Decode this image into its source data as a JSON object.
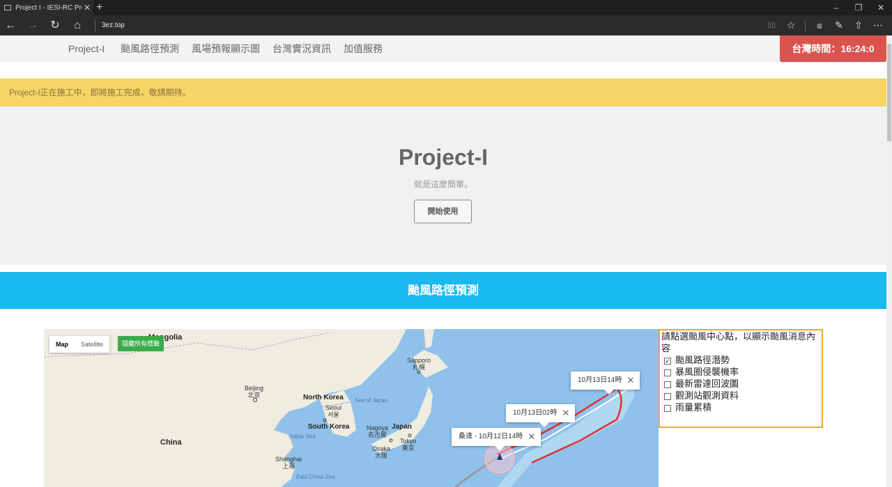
{
  "browser": {
    "tab_title": "Project I - IESI-RC Produ",
    "url": "3ez.top",
    "new_tab_symbol": "+",
    "close_symbol": "✕",
    "win_min": "–",
    "win_max": "❐",
    "win_close": "✕",
    "back": "←",
    "forward": "→",
    "refresh": "↻",
    "home": "⌂",
    "tool_reading": "▯▯",
    "tool_favorite": "☆",
    "tool_hub": "≡",
    "tool_note": "✎",
    "tool_share": "⇧",
    "tool_more": "⋯"
  },
  "navbar": {
    "brand": "Project-I",
    "items": [
      "颱風路徑預測",
      "風場預報顯示圖",
      "台灣實況資訊",
      "加值服務"
    ],
    "clock": "台灣時間：16:24:0"
  },
  "alert": {
    "text": "Project-I正在施工中，即將施工完成，敬請期待。"
  },
  "jumbotron": {
    "title": "Project-I",
    "subtitle": "就是這麼簡單。",
    "button": "開始使用"
  },
  "section": {
    "title": "颱風路徑預測"
  },
  "map": {
    "type_map": "Map",
    "type_satellite": "Satellite",
    "hide_labels": "隱藏所有標籤",
    "labels": {
      "mongolia": "Mongolia",
      "beijing": "Beijing",
      "beijing_zh": "北京",
      "china": "China",
      "north_korea": "North Korea",
      "seoul": "Seoul",
      "seoul_ko": "서울",
      "south_korea": "South Korea",
      "sea_of_japan": "Sea of Japan",
      "yellow_sea": "Yellow Sea",
      "east_china_sea": "East China Sea",
      "japan": "Japan",
      "sapporo": "Sapporo",
      "sapporo_zh": "札幌",
      "nagoya": "Nagoya",
      "nagoya_zh": "名古屋",
      "tokyo": "Tokyo",
      "tokyo_zh": "東京",
      "osaka": "Osaka",
      "osaka_zh": "大阪",
      "shanghai": "Shanghai",
      "shanghai_zh": "上海"
    },
    "infowindows": [
      {
        "text": "桑達 - 10月12日14時"
      },
      {
        "text": "10月13日02時"
      },
      {
        "text": "10月13日14時"
      }
    ],
    "colors": {
      "water": "#8fc1ea",
      "land": "#efece0",
      "track": "#e0302f",
      "cone": "#b5dbf1"
    }
  },
  "panel": {
    "instruction": "請點選颱風中心點，以顯示颱風消息內容",
    "options": [
      {
        "label": "颱風路徑潛勢",
        "checked": true
      },
      {
        "label": "暴風圈侵襲機率",
        "checked": false
      },
      {
        "label": "最新雷達回波圖",
        "checked": false
      },
      {
        "label": "觀測站觀測資料",
        "checked": false
      },
      {
        "label": "雨量累積",
        "checked": false
      }
    ]
  }
}
